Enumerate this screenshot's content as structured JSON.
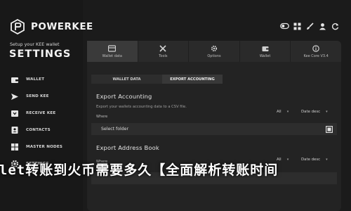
{
  "brand": {
    "name": "POWERKEE",
    "setup_text": "Setup your KEE wallet",
    "section_title": "SETTINGS"
  },
  "sidebar": {
    "items": [
      {
        "label": "WALLET",
        "icon": "wallet-icon"
      },
      {
        "label": "SEND KEE",
        "icon": "send-icon"
      },
      {
        "label": "RECEIVE KEE",
        "icon": "receive-icon"
      },
      {
        "label": "CONTACTS",
        "icon": "contacts-icon"
      },
      {
        "label": "MASTER NODES",
        "icon": "masternodes-icon"
      },
      {
        "label": "SETTINGS",
        "icon": "settings-icon"
      }
    ]
  },
  "top_icons": [
    "toggle-icon",
    "grid-icon",
    "brush-icon",
    "user-icon",
    "refresh-icon"
  ],
  "tabs": [
    {
      "label": "Wallet data",
      "icon": "wallet-data-icon"
    },
    {
      "label": "Tools",
      "icon": "tools-icon"
    },
    {
      "label": "Options",
      "icon": "options-icon"
    },
    {
      "label": "Wallet",
      "icon": "wallet-tab-icon"
    },
    {
      "label": "Kee Core V3.4",
      "icon": "kee-core-icon"
    }
  ],
  "subtabs": {
    "wallet_data": "WALLET DATA",
    "export_accounting": "EXPORT ACCOUNTING"
  },
  "export_accounting": {
    "title": "Export Accounting",
    "description": "Export your wallets accounting data to a CSV file.",
    "where_label": "Where",
    "filter_all": "All",
    "sort": "Date desc",
    "folder_placeholder": "Select folder"
  },
  "export_address_book": {
    "title": "Export Address Book",
    "where_label": "Where",
    "filter_all": "All",
    "sort": "Date desc"
  },
  "overlay_banner": "allet转账到火币需要多久【全面解析转账时间"
}
